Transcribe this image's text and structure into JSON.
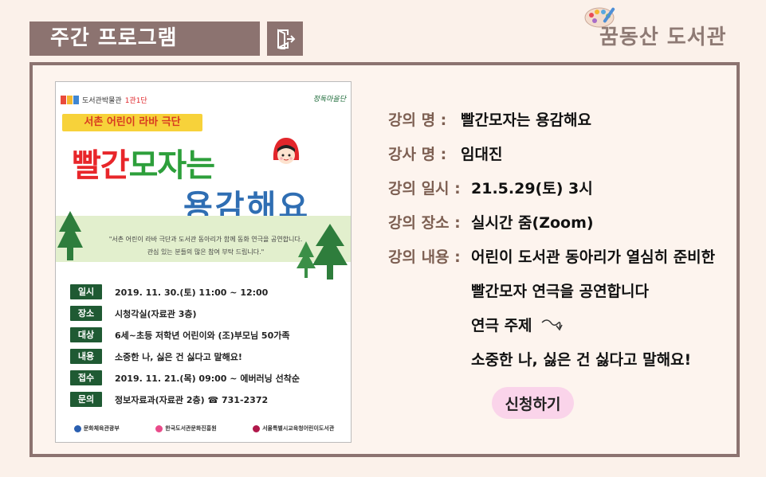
{
  "header": {
    "title": "주간 프로그램",
    "exit_icon": "exit-icon",
    "logo_text": "꿈동산 도서관",
    "logo_icon": "palette-icon"
  },
  "poster": {
    "brand": "도서관박물관",
    "brand_accent": "1관1단",
    "corner_mark": "정독마을단",
    "troupe": "서촌 어린이 라바 극단",
    "headline_part1": "빨간",
    "headline_part2": "모자는",
    "headline_line2": "용감해요",
    "quote_line1": "\"서촌 어린이 라바 극단과 도서관 동아리가 함께 동화 연극을 공연합니다.",
    "quote_line2": "관심 있는 분들의 많은 참여 부탁 드립니다.\"",
    "rows": [
      {
        "tag": "일시",
        "value": "2019. 11. 30.(토) 11:00 ~ 12:00"
      },
      {
        "tag": "장소",
        "value": "시청각실(자료관 3층)"
      },
      {
        "tag": "대상",
        "value": "6세~초등 저학년 어린이와 (조)부모님 50가족"
      },
      {
        "tag": "내용",
        "value": "소중한 나, 싫은 건 싫다고 말해요!"
      },
      {
        "tag": "접수",
        "value": "2019. 11. 21.(목) 09:00 ~ 에버러닝 선착순"
      },
      {
        "tag": "문의",
        "value": "정보자료과(자료관 2층) ☎ 731-2372"
      }
    ],
    "footer": [
      "문화체육관광부",
      "한국도서관문화진흥원",
      "서울특별시교육청어린이도서관"
    ]
  },
  "info": {
    "title_label": "강의 명 :",
    "title_value": "빨간모자는 용감해요",
    "teacher_label": "강사 명 :",
    "teacher_value": "임대진",
    "date_label": "강의 일시 :",
    "date_value": "21.5.29(토) 3시",
    "place_label": "강의 장소 :",
    "place_value": "실시간 줌(Zoom)",
    "content_label": "강의 내용 :",
    "content_line1": "어린이 도서관 동아리가 열심히 준비한",
    "content_line2": "빨간모자 연극을 공연합니다",
    "content_line3": "연극 주제",
    "content_line4": "소중한 나, 싫은 건 싫다고 말해요!",
    "arrow_icon": "curly-arrow-icon"
  },
  "apply_label": "신청하기",
  "colors": {
    "background": "#fbf1ea",
    "header_bar": "#8c7370",
    "panel_border": "#8c7370",
    "label_text": "#7d5f52",
    "apply_button": "#fad4ea",
    "poster_tag": "#1f5a33"
  }
}
